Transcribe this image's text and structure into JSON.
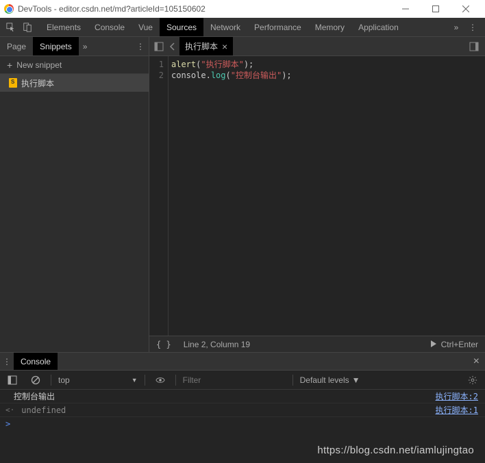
{
  "window": {
    "title": "DevTools - editor.csdn.net/md?articleId=105150602"
  },
  "tabs": [
    "Elements",
    "Console",
    "Vue",
    "Sources",
    "Network",
    "Performance",
    "Memory",
    "Application"
  ],
  "active_tab": "Sources",
  "left": {
    "tabs": [
      "Page",
      "Snippets"
    ],
    "active": "Snippets",
    "new_snippet": "New snippet",
    "items": [
      "执行脚本"
    ]
  },
  "editor": {
    "tab_name": "执行脚本",
    "lines": [
      {
        "n": "1",
        "fn": "alert",
        "str": "\"执行脚本\""
      },
      {
        "n": "2",
        "obj": "console",
        "mtd": "log",
        "str": "\"控制台输出\""
      }
    ],
    "status": {
      "braces": "{ }",
      "pos": "Line 2, Column 19",
      "run": "Ctrl+Enter"
    }
  },
  "drawer": {
    "tab": "Console",
    "toolbar": {
      "context": "top",
      "filter_placeholder": "Filter",
      "levels": "Default levels"
    },
    "rows": [
      {
        "msg": "控制台输出",
        "src": "执行脚本:2"
      },
      {
        "ret": "undefined",
        "src": "执行脚本:1"
      }
    ]
  },
  "watermark": "https://blog.csdn.net/iamlujingtao"
}
